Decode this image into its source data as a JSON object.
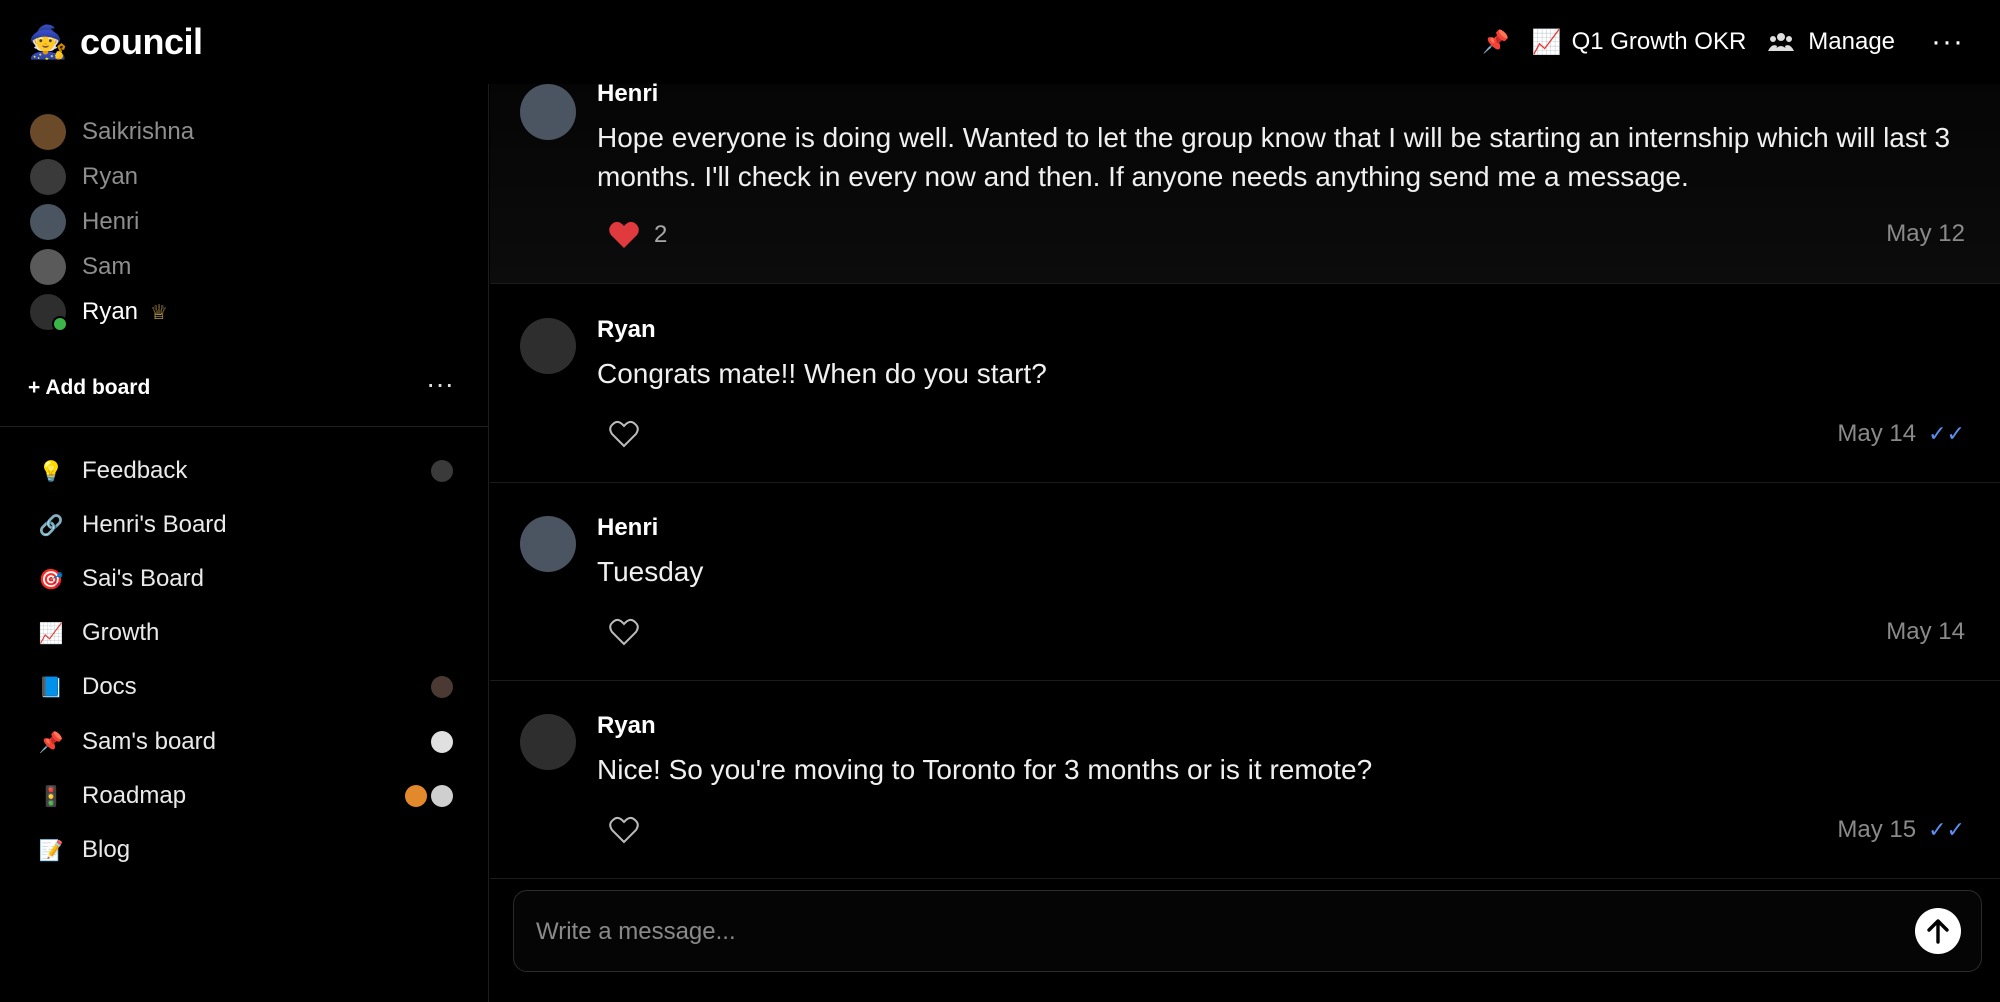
{
  "app": {
    "name": "council",
    "logo_icon": "wizard-icon"
  },
  "header": {
    "pin_icon": "pushpin-icon",
    "board_icon": "chart-increasing-icon",
    "board_title": "Q1 Growth OKR",
    "manage_label": "Manage",
    "more_label": "···"
  },
  "members": [
    {
      "name": "Saikrishna",
      "color": "#6b4a2a"
    },
    {
      "name": "Ryan",
      "color": "#3a3a3a"
    },
    {
      "name": "Henri",
      "color": "#4a5561"
    },
    {
      "name": "Sam",
      "color": "#5a5a5a"
    },
    {
      "name": "Ryan",
      "color": "#2e2e2e",
      "online": true,
      "crown": "♕"
    }
  ],
  "sidebar": {
    "add_board_label": "+ Add board",
    "more_label": "···",
    "boards": [
      {
        "icon": "💡",
        "icon_name": "lightbulb-icon",
        "label": "Feedback"
      },
      {
        "icon": "🔗",
        "icon_name": "link-icon",
        "label": "Henri's Board"
      },
      {
        "icon": "🎯",
        "icon_name": "target-icon",
        "label": "Sai's Board"
      },
      {
        "icon": "📈",
        "icon_name": "chart-increasing-icon",
        "label": "Growth"
      },
      {
        "icon": "📘",
        "icon_name": "book-icon",
        "label": "Docs"
      },
      {
        "icon": "📌",
        "icon_name": "pushpin-icon",
        "label": "Sam's board"
      },
      {
        "icon": "🚦",
        "icon_name": "traffic-light-icon",
        "label": "Roadmap"
      },
      {
        "icon": "📝",
        "icon_name": "memo-icon",
        "label": "Blog"
      }
    ]
  },
  "messages": [
    {
      "author": "Henri",
      "text": "Hope everyone is doing well. Wanted to let the group know that I will be starting an internship which will last 3 months. I'll check in every now and then. If anyone needs anything send me a message.",
      "likes": "2",
      "liked": true,
      "date": "May 12",
      "read": false
    },
    {
      "author": "Ryan",
      "text": "Congrats mate!! When do you start?",
      "likes": "",
      "liked": false,
      "date": "May 14",
      "read": true
    },
    {
      "author": "Henri",
      "text": "Tuesday",
      "likes": "",
      "liked": false,
      "date": "May 14",
      "read": false
    },
    {
      "author": "Ryan",
      "text": "Nice! So you're moving to Toronto for 3 months or is it remote?",
      "likes": "",
      "liked": false,
      "date": "May 15",
      "read": true
    }
  ],
  "composer": {
    "placeholder": "Write a message...",
    "send_icon": "arrow-up-icon"
  }
}
